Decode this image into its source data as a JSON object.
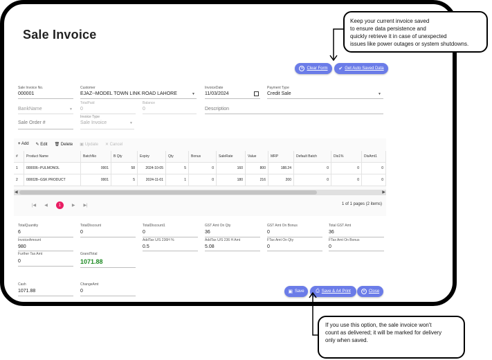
{
  "page": {
    "title": "Sale Invoice"
  },
  "top_buttons": {
    "clear_form": "Clear Form",
    "auto_saved": "Get Auto Saved Data"
  },
  "callouts": {
    "top": [
      "Keep your current invoice saved",
      "to ensure data persistence and",
      "quickly retrieve it in case of unexpected",
      "issues like power outages or system shutdowns."
    ],
    "bottom": [
      "If you use this option, the sale invoice won't",
      "count as delivered; it will be marked for delivery",
      "only when saved."
    ]
  },
  "form": {
    "sale_invoice_no": {
      "label": "Sale Invoice No.",
      "value": "000001"
    },
    "customer": {
      "label": "Customer",
      "value": "EJAZ--MODEL TOWN LINK ROAD LAHORE"
    },
    "invoice_date": {
      "label": "InvoiceDate",
      "value": "11/03/2024"
    },
    "payment_type": {
      "label": "Payment Type",
      "value": "Credit Sale"
    },
    "bank_name": {
      "placeholder": "BankName"
    },
    "total_paid": {
      "label": "TotalPaid",
      "value": "0"
    },
    "balance": {
      "label": "Balance",
      "value": "0"
    },
    "description": {
      "placeholder": "Description"
    },
    "sale_order": {
      "placeholder": "Sale Order #"
    },
    "invoice_type": {
      "label": "Invoice Type",
      "value": "Sale Invoice"
    }
  },
  "grid": {
    "toolbar": {
      "add": "Add",
      "edit": "Edit",
      "delete": "Delete",
      "update": "Update",
      "cancel": "Cancel"
    },
    "columns": [
      "#",
      "Product Name",
      "BatchNo",
      "B Qty",
      "Expiry",
      "Qty",
      "Bonus",
      "SaleRate",
      "Value",
      "MRP",
      "Default Batch",
      "Dis1%",
      "DisAmt1"
    ],
    "rows": [
      [
        "1",
        "000006--PULMONOL",
        "0001",
        "58",
        "2024-10-05",
        "5",
        "0",
        "160",
        "800",
        "188.24",
        "0",
        "0",
        "0"
      ],
      [
        "2",
        "000028--GSK PRODUCT",
        "0001",
        "5",
        "2024-11-01",
        "1",
        "0",
        "180",
        "216",
        "200",
        "0",
        "0",
        "0"
      ]
    ],
    "pager": {
      "current": "1",
      "summary": "1 of 1 pages (2 items)"
    }
  },
  "totals": {
    "total_quantity": {
      "label": "TotalQuantity",
      "value": "6"
    },
    "total_discount": {
      "label": "TotalDiscount",
      "value": "0"
    },
    "total_discount1": {
      "label": "TotalDiscount1",
      "value": "0"
    },
    "gst_amt_on_qty": {
      "label": "GST Amt On Qty",
      "value": "36"
    },
    "gst_amt_on_bonus": {
      "label": "GST Amt On Bonus",
      "value": "0"
    },
    "total_gst_amt": {
      "label": "Total GST Amt",
      "value": "36"
    },
    "invoice_amount": {
      "label": "InvoiceAmount",
      "value": "980"
    },
    "addtax_236h_pct": {
      "label": "AddTax U/S 236H %",
      "value": "0.5"
    },
    "addtax_236h_amt": {
      "label": "AddTax U/S 236 H Amt",
      "value": "5.08"
    },
    "ftax_amt_on_qty": {
      "label": "FTax Amt On Qty",
      "value": "0"
    },
    "ftax_amt_on_bonus": {
      "label": "FTax Amt On Bonus",
      "value": "0"
    },
    "further_tax_amt": {
      "label": "Further Tax Amt",
      "value": "0"
    },
    "grand_total": {
      "label": "GrandTotal",
      "value": "1071.88"
    },
    "cash": {
      "label": "Cash",
      "value": "1071.88"
    },
    "change_amt": {
      "label": "ChangeAmt",
      "value": "0"
    }
  },
  "bottom_buttons": {
    "save": "Save",
    "save_print": "Save & A4 Print",
    "close": "Close"
  },
  "colors": {
    "button": "#6b7ce8",
    "grand_total": "#1f8a24",
    "pager_active": "#e91e63"
  }
}
